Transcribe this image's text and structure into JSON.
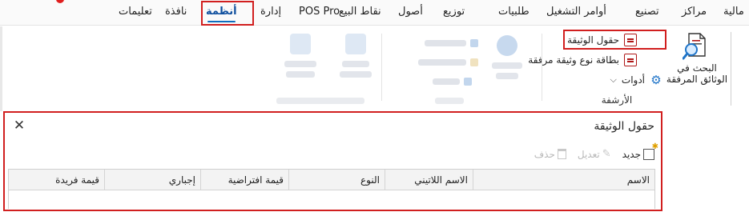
{
  "menu": {
    "items": [
      "مالية",
      "مراكز",
      "تصنيع",
      "أوامر التشغيل",
      "طلبيات",
      "توزيع",
      "أصول",
      "نقاط البيع",
      "POS Pro",
      "إدارة",
      "أنظمة",
      "نافذة",
      "تعليمات"
    ],
    "active": "أنظمة"
  },
  "ribbon": {
    "search_attachments": {
      "label_line1": "البحث في",
      "label_line2": "الوثائق المرفقة",
      "icon": "document-search-icon"
    },
    "buttons": [
      {
        "label": "حقول الوثيقة",
        "icon": "document-icon"
      },
      {
        "label": "بطاقة نوع وثيقة مرفقة",
        "icon": "document-icon"
      },
      {
        "label": "أدوات",
        "icon": "gear-icon",
        "dropdown": true
      }
    ],
    "group_label": "الأرشفة"
  },
  "panel": {
    "title": "حقول الوثيقة",
    "close_icon": "close-icon",
    "toolbar": {
      "new_label": "جديد",
      "edit_label": "تعديل",
      "delete_label": "حذف"
    },
    "columns": [
      "الاسم",
      "الاسم اللاتيني",
      "النوع",
      "قيمة افتراضية",
      "إجباري",
      "قيمة فريدة"
    ],
    "rows": []
  },
  "colors": {
    "highlight": "#d11f1f",
    "accent": "#0f6cbd",
    "disabled": "#b8b8b8"
  }
}
